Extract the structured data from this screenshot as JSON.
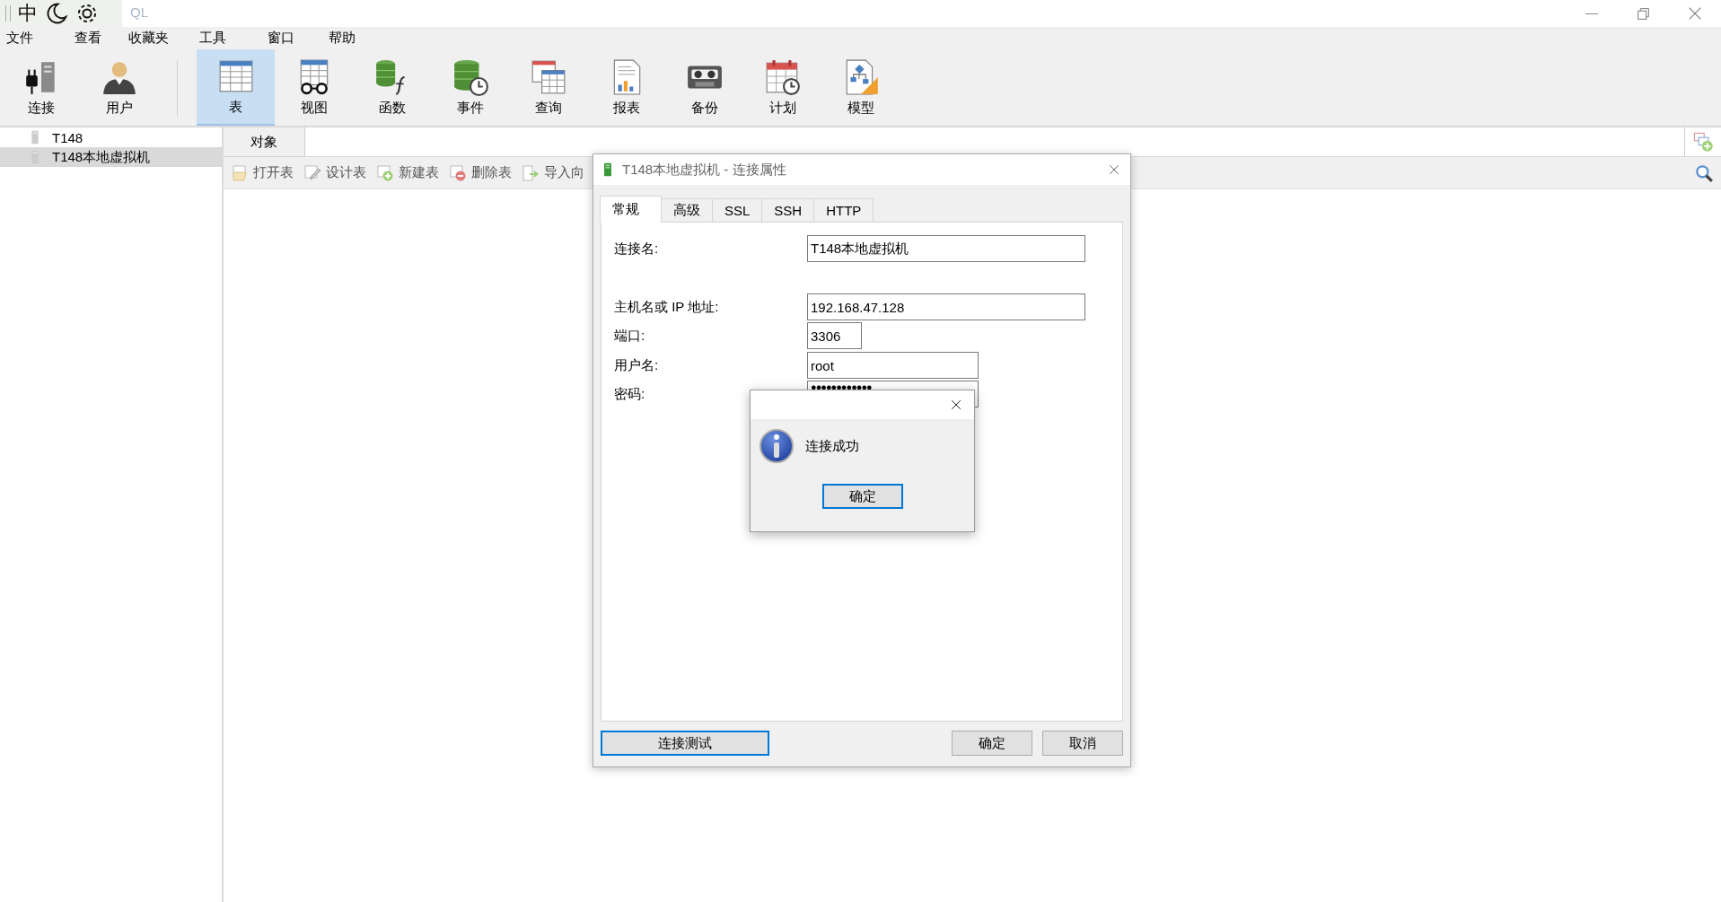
{
  "window": {
    "title": "QL"
  },
  "ime_bar": {
    "mode": "中"
  },
  "menu": [
    "文件",
    "查看",
    "收藏夹",
    "工具",
    "窗口",
    "帮助"
  ],
  "toolbar": [
    {
      "label": "连接",
      "selected": false
    },
    {
      "label": "用户",
      "selected": false
    },
    {
      "label": "表",
      "selected": true
    },
    {
      "label": "视图",
      "selected": false
    },
    {
      "label": "函数",
      "selected": false
    },
    {
      "label": "事件",
      "selected": false
    },
    {
      "label": "查询",
      "selected": false
    },
    {
      "label": "报表",
      "selected": false
    },
    {
      "label": "备份",
      "selected": false
    },
    {
      "label": "计划",
      "selected": false
    },
    {
      "label": "模型",
      "selected": false
    }
  ],
  "sidebar": {
    "items": [
      {
        "label": "T148",
        "selected": false
      },
      {
        "label": "T148本地虚拟机",
        "selected": true
      }
    ]
  },
  "object_tabs": [
    {
      "label": "对象",
      "selected": true
    }
  ],
  "object_toolbar": [
    "打开表",
    "设计表",
    "新建表",
    "删除表",
    "导入向"
  ],
  "dialog": {
    "title": "T148本地虚拟机 - 连接属性",
    "tabs": [
      {
        "label": "常规",
        "selected": true
      },
      {
        "label": "高级",
        "selected": false
      },
      {
        "label": "SSL",
        "selected": false
      },
      {
        "label": "SSH",
        "selected": false
      },
      {
        "label": "HTTP",
        "selected": false
      }
    ],
    "fields": [
      {
        "label": "连接名:",
        "value": "T148本地虚拟机",
        "kind": "text"
      },
      {
        "label": "主机名或 IP 地址:",
        "value": "192.168.47.128",
        "kind": "text"
      },
      {
        "label": "端口:",
        "value": "3306",
        "kind": "text"
      },
      {
        "label": "用户名:",
        "value": "root",
        "kind": "text"
      },
      {
        "label": "密码:",
        "value": "●●●●●●●●●●●●",
        "kind": "password"
      }
    ],
    "buttons": [
      {
        "label": "连接测试",
        "focused": true
      },
      {
        "label": "确定",
        "focused": false
      },
      {
        "label": "取消",
        "focused": false
      }
    ]
  },
  "message_box": {
    "message": "连接成功",
    "button": {
      "label": "确定",
      "focused": true
    }
  }
}
